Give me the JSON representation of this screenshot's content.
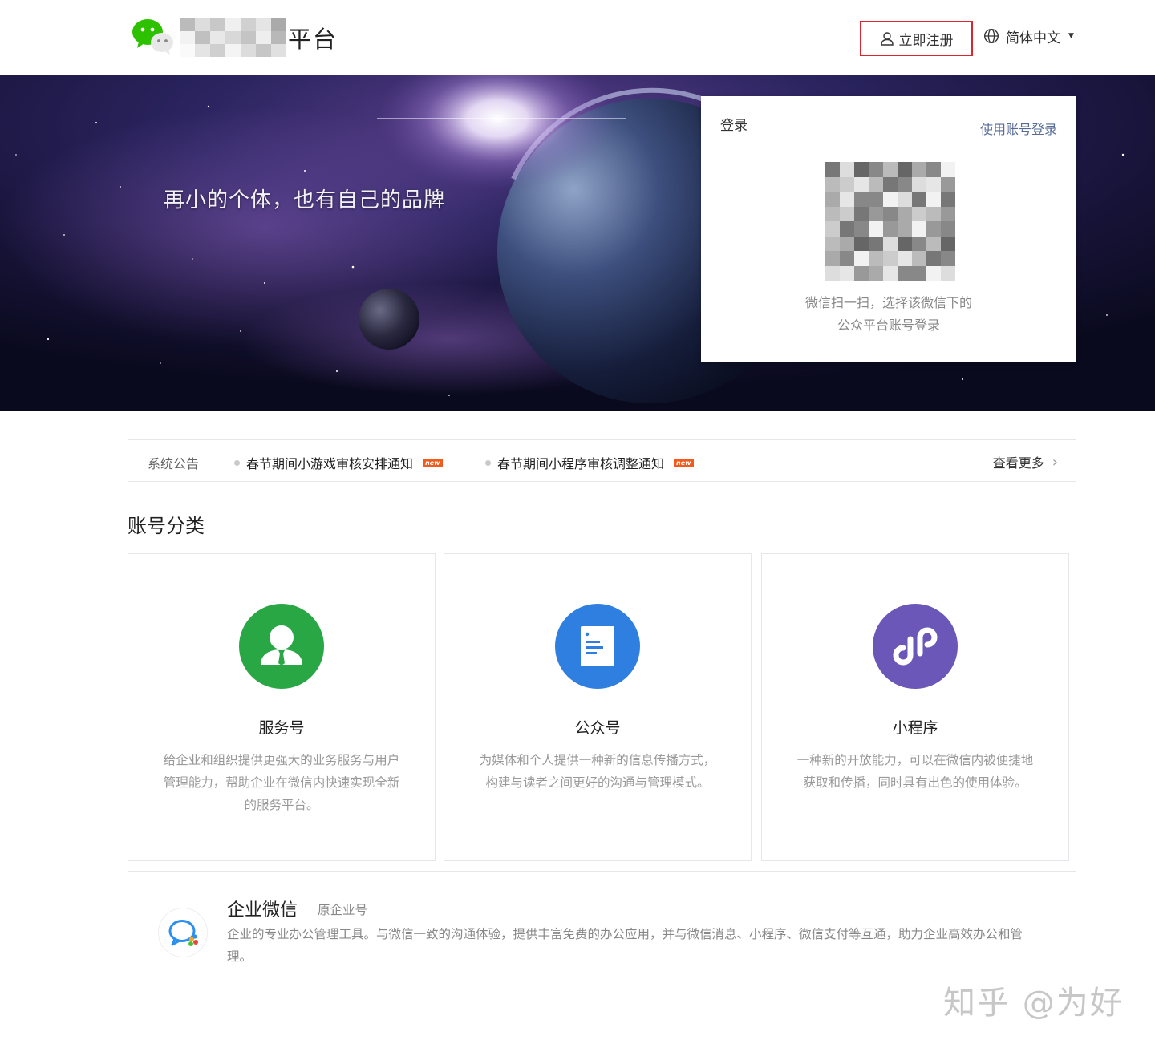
{
  "header": {
    "brand_suffix": "平台",
    "register_label": "立即注册",
    "language_label": "简体中文"
  },
  "banner": {
    "slogan": "再小的个体，也有自己的品牌"
  },
  "login": {
    "title": "登录",
    "switch_label": "使用账号登录",
    "hint_line1": "微信扫一扫，选择该微信下的",
    "hint_line2": "公众平台账号登录"
  },
  "notice": {
    "title": "系统公告",
    "items": [
      {
        "text": "春节期间小游戏审核安排通知",
        "badge": "new"
      },
      {
        "text": "春节期间小程序审核调整通知",
        "badge": "new"
      }
    ],
    "more_label": "查看更多"
  },
  "section": {
    "title": "账号分类"
  },
  "cards": [
    {
      "title": "服务号",
      "desc": "给企业和组织提供更强大的业务服务与用户管理能力，帮助企业在微信内快速实现全新的服务平台。",
      "color": "#29a745",
      "icon": "service-account-icon"
    },
    {
      "title": "公众号",
      "desc": "为媒体和个人提供一种新的信息传播方式，构建与读者之间更好的沟通与管理模式。",
      "color": "#2f7fe0",
      "icon": "official-account-icon"
    },
    {
      "title": "小程序",
      "desc": "一种新的开放能力，可以在微信内被便捷地获取和传播，同时具有出色的使用体验。",
      "color": "#6b57b7",
      "icon": "mini-program-icon"
    }
  ],
  "work_wechat": {
    "title": "企业微信",
    "subtitle": "原企业号",
    "desc": "企业的专业办公管理工具。与微信一致的沟通体验，提供丰富免费的办公应用，并与微信消息、小程序、微信支付等互通，助力企业高效办公和管理。",
    "icon": "work-wechat-icon"
  },
  "watermark": {
    "text": "知乎 @为好"
  },
  "colors": {
    "link": "#576b95",
    "highlight_border": "#d9262f",
    "new_badge": "#f25b1e"
  }
}
